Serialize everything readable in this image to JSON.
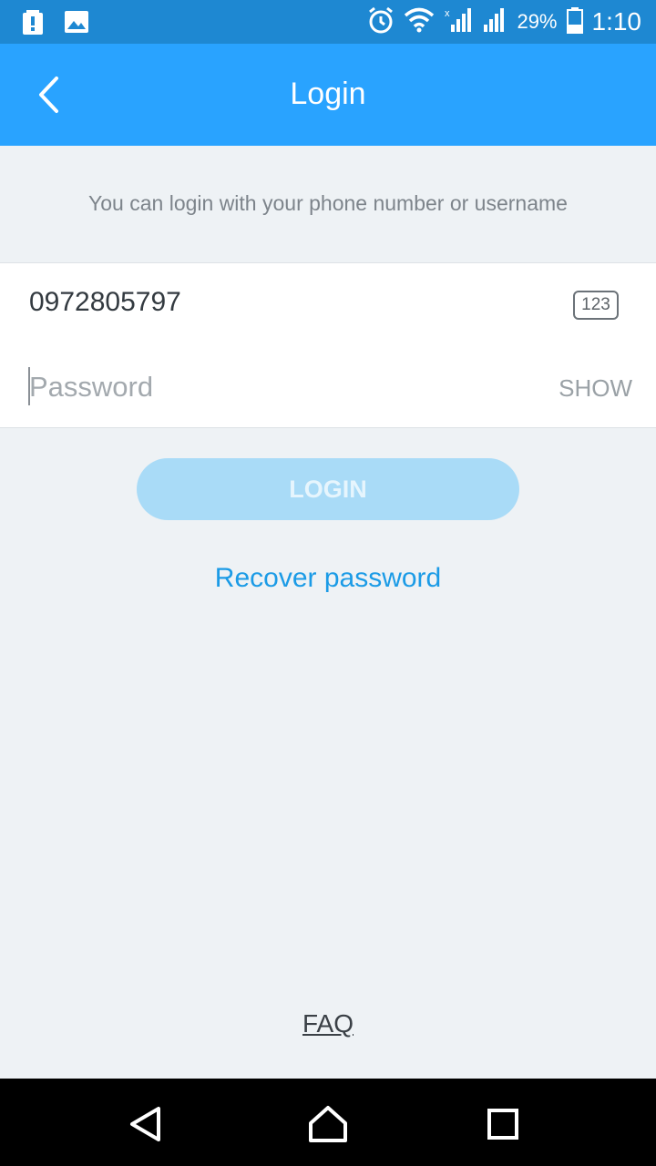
{
  "status_bar": {
    "icons_left": [
      "battery-alert-icon",
      "image-icon"
    ],
    "icons_right": [
      "alarm-icon",
      "wifi-icon",
      "cell-signal-icon",
      "cell-signal-icon",
      "battery-icon"
    ],
    "battery_percent": "29%",
    "time": "1:10"
  },
  "app_bar": {
    "title": "Login",
    "background": "#29a3ff"
  },
  "hint": "You can login with your phone number or username",
  "phone_field": {
    "value": "0972805797",
    "keyboard_badge": "123"
  },
  "password_field": {
    "placeholder": "Password",
    "toggle_label": "SHOW"
  },
  "login_button": {
    "label": "LOGIN",
    "color": "#a9dbf7"
  },
  "recover_link": "Recover password",
  "faq_link": "FAQ",
  "accent_color": "#1b9be6"
}
